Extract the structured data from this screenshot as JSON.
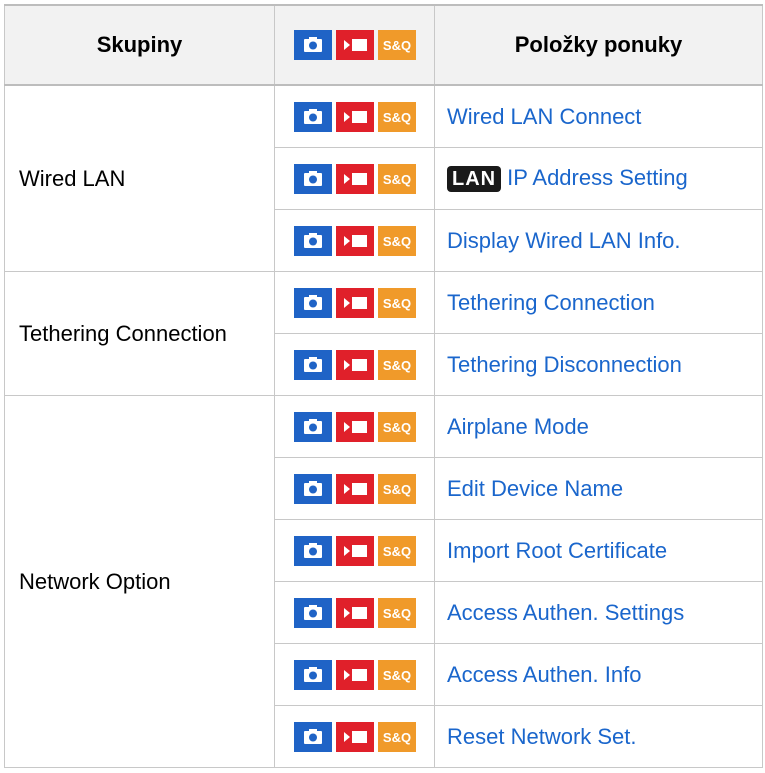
{
  "header": {
    "col_group": "Skupiny",
    "col_items": "Položky ponuky",
    "mode_icons": [
      "photo-mode-icon",
      "movie-mode-icon",
      "sq-mode-icon"
    ],
    "sq_label": "S&Q"
  },
  "colors": {
    "photo_mode": "#1f63c6",
    "movie_mode": "#e0202a",
    "sq_mode": "#f09a2a",
    "link": "#1a66cc",
    "header_bg": "#f2f2f2",
    "border": "#c8c8c8"
  },
  "groups": [
    {
      "name": "Wired LAN",
      "items": [
        {
          "label": "Wired LAN Connect"
        },
        {
          "badge": "LAN",
          "label": "IP Address Setting"
        },
        {
          "label": "Display Wired LAN Info."
        }
      ]
    },
    {
      "name": "Tethering Connection",
      "items": [
        {
          "label": "Tethering Connection"
        },
        {
          "label": "Tethering Disconnection"
        }
      ]
    },
    {
      "name": "Network Option",
      "items": [
        {
          "label": "Airplane Mode"
        },
        {
          "label": "Edit Device Name"
        },
        {
          "label": "Import Root Certificate"
        },
        {
          "label": "Access Authen. Settings"
        },
        {
          "label": "Access Authen. Info"
        },
        {
          "label": "Reset Network Set."
        }
      ]
    }
  ]
}
